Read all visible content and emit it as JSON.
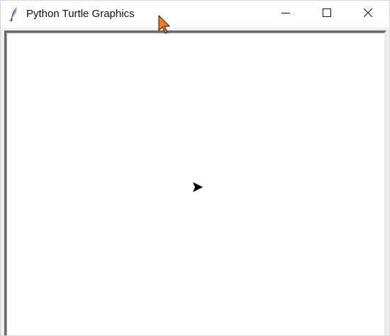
{
  "window": {
    "title": "Python Turtle Graphics",
    "icon": "feather-icon"
  },
  "caption_buttons": {
    "minimize": "minimize-icon",
    "maximize": "maximize-icon",
    "close": "close-icon"
  },
  "canvas": {
    "background": "#ffffff",
    "turtle_shape": "arrow",
    "turtle_color": "#000000",
    "turtle_heading": "east"
  },
  "cursor": {
    "icon": "mouse-pointer-icon",
    "color": "#f57c1f"
  }
}
